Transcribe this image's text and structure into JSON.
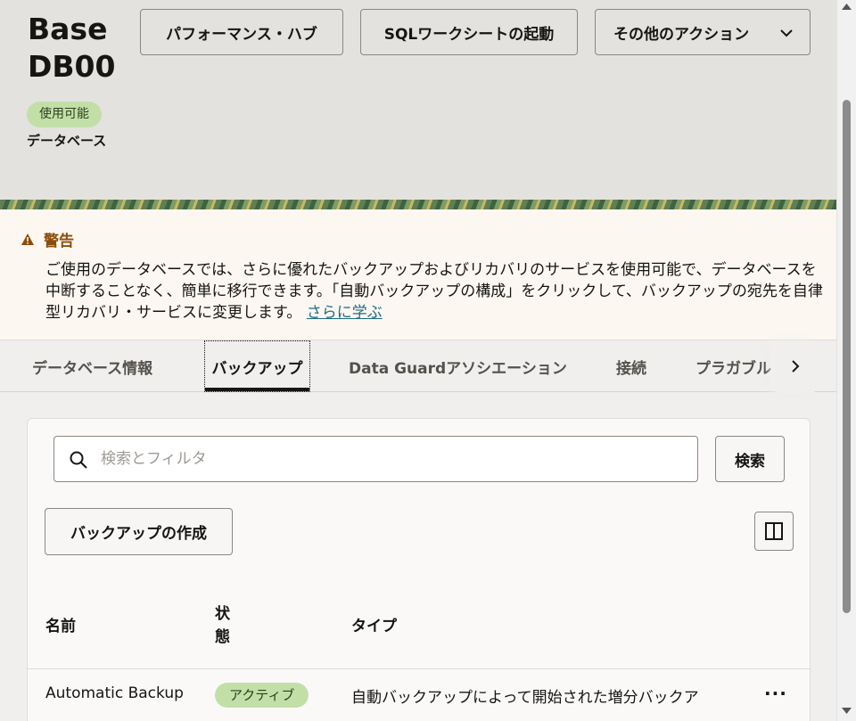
{
  "header": {
    "title": "BaseDB00",
    "status": "使用可能",
    "type": "データベース",
    "buttons": {
      "performance_hub": "パフォーマンス・ハブ",
      "sql_worksheet": "SQLワークシートの起動",
      "more_actions": "その他のアクション"
    }
  },
  "warning": {
    "title": "警告",
    "text": "ご使用のデータベースでは、さらに優れたバックアップおよびリカバリのサービスを使用可能で、データベースを中断することなく、簡単に移行できます。「自動バックアップの構成」をクリックして、バックアップの宛先を自律型リカバリ・サービスに変更します。",
    "link": "さらに学ぶ"
  },
  "tabs": [
    {
      "label": "データベース情報"
    },
    {
      "label": "バックアップ"
    },
    {
      "label": "Data Guardアソシエーション"
    },
    {
      "label": "接続"
    },
    {
      "label": "プラガブル"
    }
  ],
  "backups": {
    "search_placeholder": "検索とフィルタ",
    "search_button": "検索",
    "create_button": "バックアップの作成",
    "columns": {
      "name": "名前",
      "state": "状態",
      "type": "タイプ"
    },
    "rows": [
      {
        "name": "Automatic Backup",
        "state": "アクティブ",
        "type": "自動バックアップによって開始された増分バックア",
        "actions": "···"
      }
    ]
  },
  "colors": {
    "status_green": "#c2dfa8",
    "warning_brown": "#8d4d0a",
    "link": "#1d6c85"
  }
}
